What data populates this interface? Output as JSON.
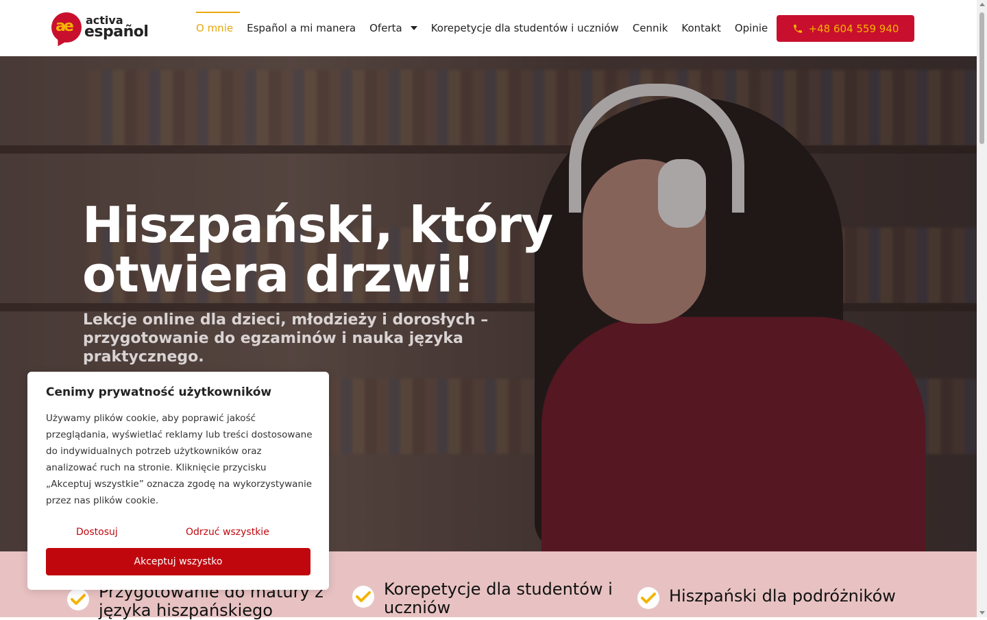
{
  "logo": {
    "line1": "activa",
    "line2": "español",
    "mark": "ae"
  },
  "nav": {
    "items": [
      {
        "label": "O mnie",
        "active": true
      },
      {
        "label": "Español a mi manera"
      },
      {
        "label": "Oferta",
        "has_dropdown": true
      },
      {
        "label": "Korepetycje dla studentów i uczniów"
      },
      {
        "label": "Cennik"
      },
      {
        "label": "Kontakt"
      },
      {
        "label": "Opinie"
      }
    ],
    "phone": {
      "icon": "phone-icon",
      "label": "+48 604 559 940"
    }
  },
  "hero": {
    "title": "Hiszpański, który otwiera drzwi!",
    "subtitle": "Lekcje online dla dzieci, młodzieży i dorosłych – przygotowanie do egzaminów i nauka języka praktycznego."
  },
  "features": [
    {
      "icon": "check-icon",
      "label": "Przygotowanie do matury z języka hiszpańskiego"
    },
    {
      "icon": "check-icon",
      "label": "Korepetycje dla studentów i uczniów"
    },
    {
      "icon": "check-icon",
      "label": "Hiszpański dla podróżników"
    }
  ],
  "cookie": {
    "title": "Cenimy prywatność użytkowników",
    "text": "Używamy plików cookie, aby poprawić jakość przeglądania, wyświetlać reklamy lub treści dostosowane do indywidualnych potrzeb użytkowników oraz analizować ruch na stronie. Kliknięcie przycisku „Akceptuj wszystkie” oznacza zgodę na wykorzystywanie przez nas plików cookie.",
    "customize": "Dostosuj",
    "reject": "Odrzuć wszystkie",
    "accept": "Akceptuj wszystko"
  },
  "colors": {
    "accent": "#e8a80c",
    "brand_red": "#c8102e",
    "features_bg": "#e8c2c2"
  }
}
